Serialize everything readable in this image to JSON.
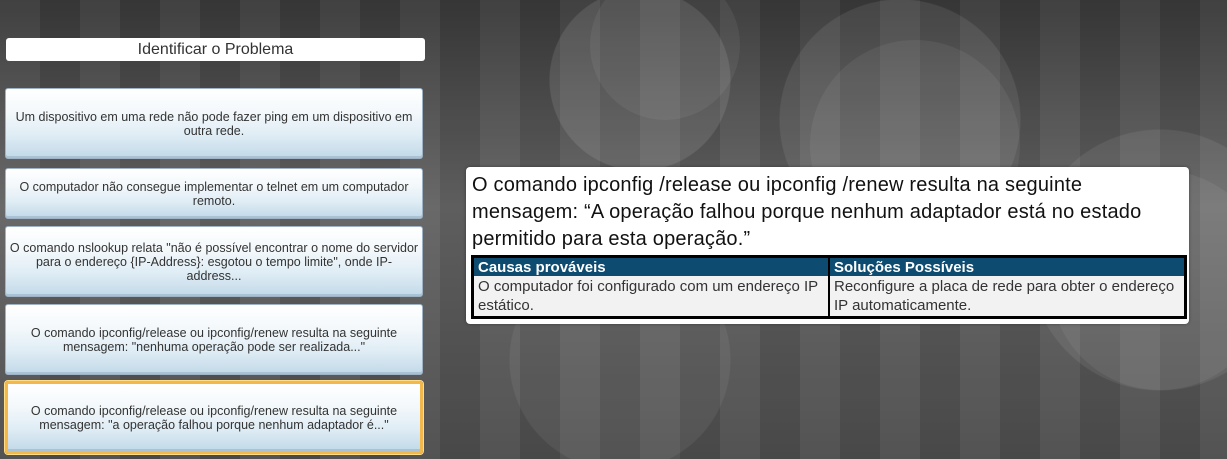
{
  "panel": {
    "title": "Identificar o Problema",
    "problems": [
      "Um dispositivo em uma rede não pode fazer ping em um dispositivo em outra rede.",
      "O computador não consegue implementar o telnet em um computador remoto.",
      "O comando nslookup relata \"não é possível encontrar o nome do servidor para o endereço {IP-Address}: esgotou o tempo limite\", onde IP-address...",
      "O comando ipconfig/release ou ipconfig/renew resulta na seguinte mensagem: \"nenhuma operação pode ser realizada...\"",
      "O comando ipconfig/release ou ipconfig/renew resulta na seguinte mensagem: \"a operação falhou porque nenhum adaptador é...\""
    ],
    "selected_index": 4
  },
  "detail": {
    "message": "O comando ipconfig /release ou ipconfig /renew resulta na seguinte mensagem: “A operação falhou porque nenhum adaptador está no estado permitido para esta operação.”",
    "table": {
      "headers": [
        "Causas prováveis",
        "Soluções Possíveis"
      ],
      "rows": [
        [
          "O computador foi configurado com um endereço IP estático.",
          "Reconfigure a placa de rede para obter o endereço IP automaticamente."
        ]
      ]
    }
  }
}
